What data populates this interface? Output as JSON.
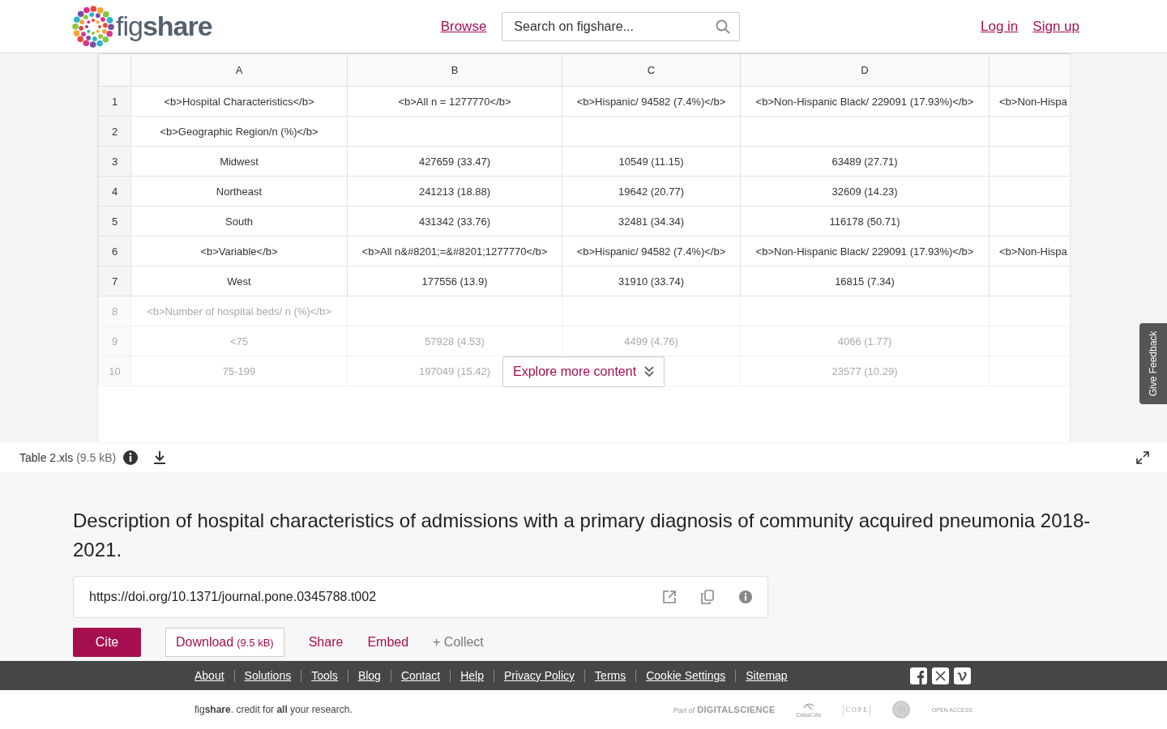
{
  "header": {
    "logo": "fig**share**",
    "nav_link": "Browse",
    "search": {
      "placeholder": "Search on figshare..."
    },
    "auth_links": [
      "Log in",
      "Sign up"
    ]
  },
  "spreadsheet": {
    "columns": [
      "A",
      "B",
      "C",
      "D"
    ],
    "rows": [
      {
        "number": "1",
        "faded": false,
        "cells": [
          "<b>Hospital Characteristics</b>",
          "<b>All n = 1277770</b>",
          "<b>Hispanic/ 94582 (7.4%)</b>",
          "<b>Non-Hispanic Black/ 229091 (17.93%)</b>",
          "<b>Non-Hispa"
        ]
      },
      {
        "number": "2",
        "faded": false,
        "cells": [
          "<b>Geographic Region/n (%)</b>",
          null,
          null,
          null,
          null
        ]
      },
      {
        "number": "3",
        "faded": false,
        "cells": [
          "Midwest",
          "427659 (33.47)",
          "10549 (11.15)",
          "63489 (27.71)",
          null
        ]
      },
      {
        "number": "4",
        "faded": false,
        "cells": [
          "Northeast",
          "241213 (18.88)",
          "19642 (20.77)",
          "32609 (14.23)",
          null
        ]
      },
      {
        "number": "5",
        "faded": false,
        "cells": [
          "South",
          "431342 (33.76)",
          "32481 (34.34)",
          "116178 (50.71)",
          null
        ]
      },
      {
        "number": "6",
        "faded": false,
        "cells": [
          "<b>Variable</b>",
          "<b>All n&#8201;=&#8201;1277770</b>",
          "<b>Hispanic/ 94582 (7.4%)</b>",
          "<b>Non-Hispanic Black/ 229091 (17.93%)</b>",
          "<b>Non-Hispa"
        ]
      },
      {
        "number": "7",
        "faded": false,
        "cells": [
          "West",
          "177556 (13.9)",
          "31910 (33.74)",
          "16815 (7.34)",
          null
        ]
      },
      {
        "number": "8",
        "faded": true,
        "cells": [
          "<b>Number of hospital beds/ n (%)</b>",
          null,
          null,
          null,
          null
        ]
      },
      {
        "number": "9",
        "faded": true,
        "cells": [
          "<75",
          "57928 (4.53)",
          "4499 (4.76)",
          "4066 (1.77)",
          null
        ]
      },
      {
        "number": "10",
        "faded": true,
        "cells": [
          "75-199",
          "197049 (15.42)",
          null,
          "23577 (10.29)",
          null
        ]
      }
    ],
    "explore_button": "Explore more content"
  },
  "feedback_tab": "Give Feedback",
  "file_bar": {
    "name": "Table 2.xls",
    "size": "(9.5 kB)"
  },
  "item": {
    "title": "Description of hospital characteristics of admissions with a primary diagnosis of community acquired pneumonia 2018-2021.",
    "doi": "https://doi.org/10.1371/journal.pone.0345788.t002",
    "actions": [
      {
        "kind": "primary",
        "label": "Cite"
      },
      {
        "kind": "outline",
        "label": "Download",
        "extra": "(9.5 kB)"
      },
      {
        "kind": "link",
        "label": "Share"
      },
      {
        "kind": "link",
        "label": "Embed"
      },
      {
        "kind": "muted",
        "label": "+ Collect"
      }
    ]
  },
  "footer": {
    "links": [
      "About",
      "Solutions",
      "Tools",
      "Blog",
      "Contact",
      "Help",
      "Privacy Policy",
      "Terms",
      "Cookie Settings",
      "Sitemap"
    ],
    "tagline": "fig**share**. credit for **all** your research.",
    "partner_logos": {
      "part_of": "Part of",
      "digital_science": "DIGITALSCIENCE",
      "datacite": "DataCite",
      "cope": "C O P E",
      "open_access": "OPEN ACCESS"
    }
  }
}
